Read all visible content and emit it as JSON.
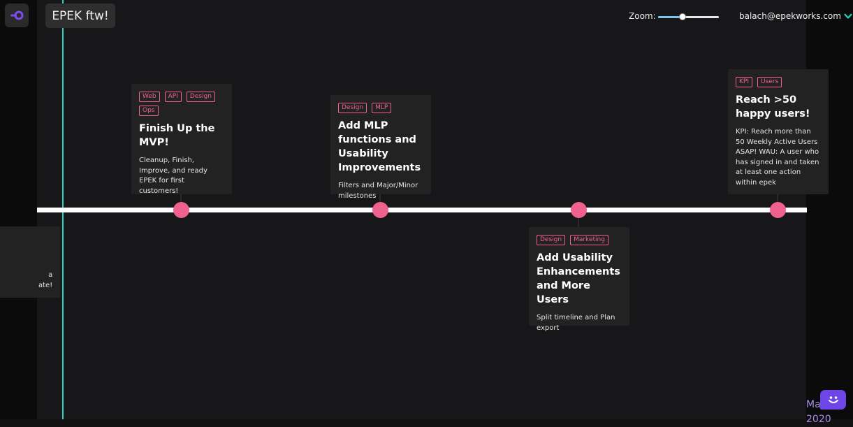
{
  "app": {
    "title": "EPEK ftw!",
    "logo_icon": "epek-logo-icon"
  },
  "header": {
    "zoom_label": "Zoom:",
    "zoom_level": 0.4,
    "user_email": "balach@epekworks.com"
  },
  "colors": {
    "accent": "#f0628e",
    "now_line": "#2bd1c0",
    "brand": "#6e45e6"
  },
  "milestones": [
    {
      "tags": [
        "Web",
        "API",
        "Design",
        "Ops"
      ],
      "title": "Finish Up the MVP!",
      "description": "Cleanup, Finish, Improve, and ready EPEK for first customers!"
    },
    {
      "tags": [
        "Design",
        "MLP"
      ],
      "title": "Add MLP functions and Usability Improvements",
      "description": "Filters and Major/Minor milestones"
    },
    {
      "tags": [
        "Design",
        "Marketing"
      ],
      "title": "Add Usability Enhancements and More Users",
      "description": "Split timeline and Plan export"
    },
    {
      "tags": [
        "KPI",
        "Users"
      ],
      "title": "Reach >50 happy users!",
      "description": "KPI: Reach more than 50 Weekly Active Users ASAP! WAU: A user who has signed in and taken at least one action within epek"
    }
  ],
  "partial_card": {
    "line1": "a",
    "line2": "ate!"
  },
  "month_label": {
    "month": "Ma",
    "year": "2020"
  }
}
